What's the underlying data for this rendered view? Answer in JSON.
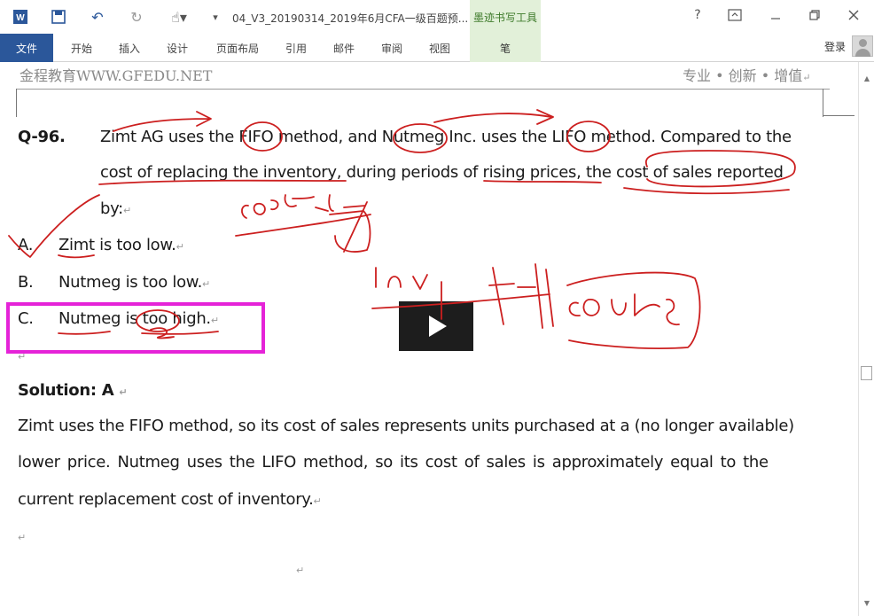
{
  "app": {
    "document_title": "04_V3_20190314_2019年6月CFA一级百题预...",
    "contextual_tab_group": "墨迹书写工具"
  },
  "ribbon": {
    "tabs": [
      "文件",
      "开始",
      "插入",
      "设计",
      "页面布局",
      "引用",
      "邮件",
      "审阅",
      "视图",
      "笔"
    ],
    "login": "登录"
  },
  "window_controls": {
    "help": "?",
    "restore": "🗗",
    "close": "✕"
  },
  "page_header": {
    "left": "金程教育WWW.GFEDU.NET",
    "right": "专业 • 创新 • 增值"
  },
  "question": {
    "number": "Q-96.",
    "stem_line1": "Zimt AG uses the FIFO method, and Nutmeg Inc. uses the LIFO method. Compared to the",
    "stem_line2": "cost of replacing the inventory, during periods of rising prices, the cost of sales reported",
    "stem_line3": "by:",
    "options": [
      {
        "letter": "A.",
        "text": "Zimt is too low."
      },
      {
        "letter": "B.",
        "text": "Nutmeg is too low."
      },
      {
        "letter": "C.",
        "text": "Nutmeg is too high."
      }
    ]
  },
  "solution": {
    "heading": "Solution: A",
    "line1": "Zimt uses the FIFO method, so its cost of sales represents units purchased at a (no longer available)",
    "line2": "lower price. Nutmeg uses the LIFO method, so its cost of sales is approximately equal to the",
    "line3": "current replacement cost of inventory."
  },
  "paragraph_mark": "↵",
  "colors": {
    "word_blue": "#2b579a",
    "ink_tools_green": "#e2f0d9",
    "highlight_magenta": "#e523d8",
    "ink_red": "#cc1f1f"
  },
  "icons": [
    "word-icon",
    "save-icon",
    "undo-icon",
    "redo-icon",
    "touch-mode-icon",
    "customize-icon",
    "help-icon",
    "ribbon-display-icon",
    "minimize-icon",
    "restore-icon",
    "close-icon",
    "avatar-icon",
    "play-icon"
  ]
}
